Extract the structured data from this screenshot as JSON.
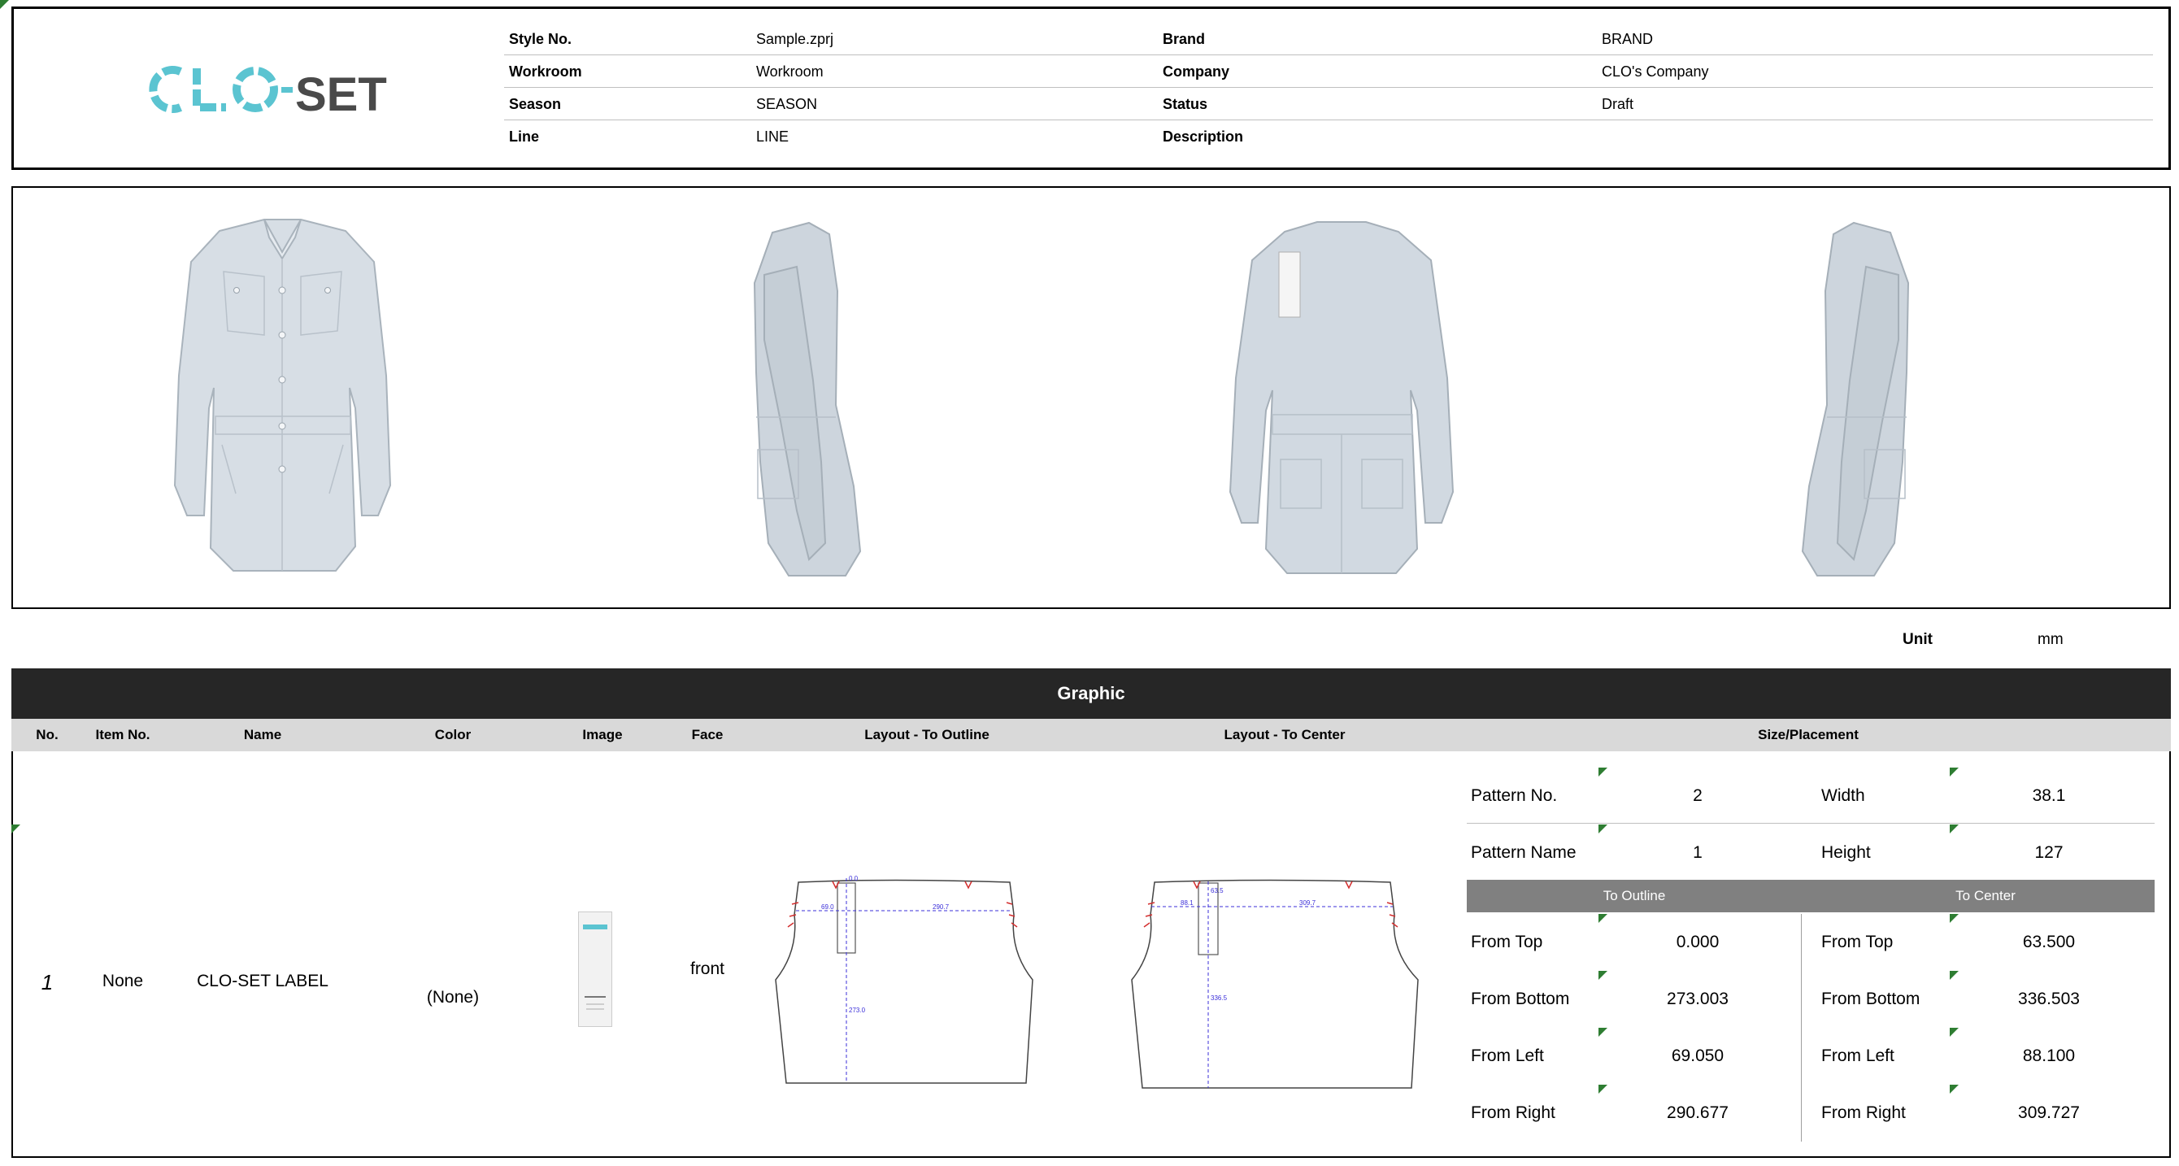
{
  "header": {
    "logo_text": "CLO-SET",
    "rows": [
      {
        "label1": "Style No.",
        "value1": "Sample.zprj",
        "label2": "Brand",
        "value2": "BRAND"
      },
      {
        "label1": "Workroom",
        "value1": "Workroom",
        "label2": "Company",
        "value2": "CLO's Company"
      },
      {
        "label1": "Season",
        "value1": "SEASON",
        "label2": "Status",
        "value2": "Draft"
      },
      {
        "label1": "Line",
        "value1": "LINE",
        "label2": "Description",
        "value2": ""
      }
    ]
  },
  "unit": {
    "label": "Unit",
    "value": "mm"
  },
  "graphic": {
    "title": "Graphic",
    "columns": [
      "No.",
      "Item No.",
      "Name",
      "Color",
      "Image",
      "Face",
      "Layout - To Outline",
      "Layout - To Center",
      "Size/Placement"
    ],
    "row": {
      "no": "1",
      "item_no": "None",
      "name": "CLO-SET LABEL",
      "color": "(None)",
      "face": "front",
      "outline_dims": [
        "0.0",
        "69.0",
        "290.7",
        "273.0"
      ],
      "center_dims": [
        "63.5",
        "88.1",
        "309.7",
        "336.5"
      ]
    },
    "size_placement": {
      "pattern_no_label": "Pattern No.",
      "pattern_no": "2",
      "width_label": "Width",
      "width": "38.1",
      "pattern_name_label": "Pattern Name",
      "pattern_name": "1",
      "height_label": "Height",
      "height": "127",
      "to_outline_label": "To Outline",
      "to_center_label": "To Center",
      "outline": [
        {
          "label": "From Top",
          "value": "0.000"
        },
        {
          "label": "From Bottom",
          "value": "273.003"
        },
        {
          "label": "From Left",
          "value": "69.050"
        },
        {
          "label": "From Right",
          "value": "290.677"
        }
      ],
      "center": [
        {
          "label": "From Top",
          "value": "63.500"
        },
        {
          "label": "From Bottom",
          "value": "336.503"
        },
        {
          "label": "From Left",
          "value": "88.100"
        },
        {
          "label": "From Right",
          "value": "309.727"
        }
      ]
    }
  },
  "colors": {
    "logo_cyan": "#5bc4d1",
    "logo_gray": "#4a4a4a",
    "garment": "#d7dee5",
    "header_bar": "#262626",
    "marker_green": "#2e7d32",
    "dimension_blue": "#3b2fd9",
    "notch_red": "#d32f2f"
  }
}
